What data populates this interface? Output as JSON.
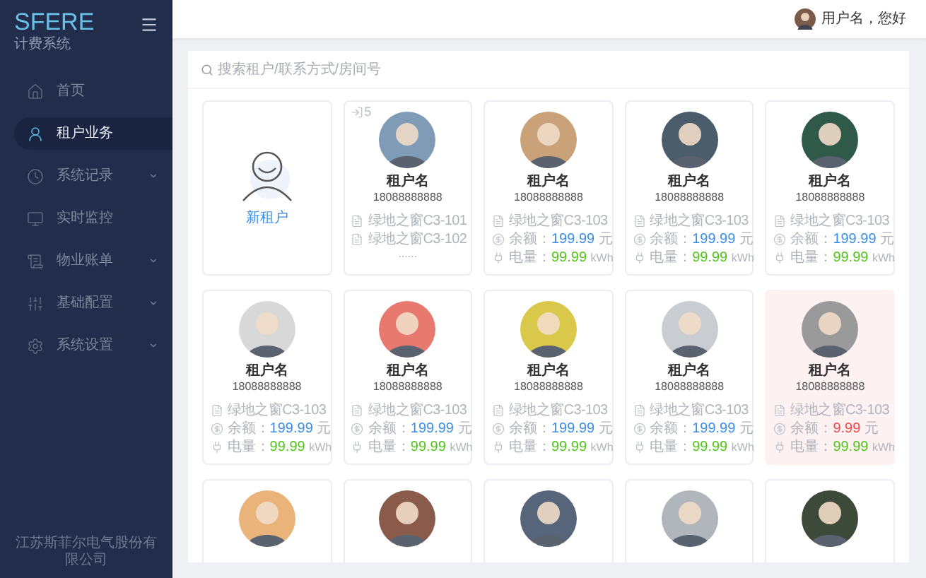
{
  "sidebar": {
    "logo": "SFERE",
    "subtitle": "计费系统",
    "items": [
      {
        "label": "首页",
        "selected": false,
        "expandable": false
      },
      {
        "label": "租户业务",
        "selected": true,
        "expandable": false
      },
      {
        "label": "系统记录",
        "selected": false,
        "expandable": true
      },
      {
        "label": "实时监控",
        "selected": false,
        "expandable": false
      },
      {
        "label": "物业账单",
        "selected": false,
        "expandable": true
      },
      {
        "label": "基础配置",
        "selected": false,
        "expandable": true
      },
      {
        "label": "系统设置",
        "selected": false,
        "expandable": true
      }
    ],
    "footer": "江苏斯菲尔电气股份有限公司"
  },
  "header": {
    "greeting": "用户名，您好"
  },
  "search": {
    "placeholder": "搜索租户/联系方式/房间号"
  },
  "cards": [
    {
      "kind": "add",
      "label": "新租户"
    },
    {
      "kind": "rooms",
      "badge": "5",
      "name": "租户名",
      "phone": "18088888888",
      "rooms": [
        "绿地之窗C3-101",
        "绿地之窗C3-102"
      ],
      "more": "......"
    },
    {
      "kind": "tenant",
      "name": "租户名",
      "phone": "18088888888",
      "rooms": [
        "绿地之窗C3-103"
      ],
      "balance_label": "余额：",
      "balance": "199.99",
      "balance_unit": "元",
      "energy_label": "电量：",
      "energy": "99.99",
      "energy_unit": "kWh",
      "low_balance": false
    },
    {
      "kind": "tenant",
      "name": "租户名",
      "phone": "18088888888",
      "rooms": [
        "绿地之窗C3-103"
      ],
      "balance_label": "余额：",
      "balance": "199.99",
      "balance_unit": "元",
      "energy_label": "电量：",
      "energy": "99.99",
      "energy_unit": "kWh",
      "low_balance": false
    },
    {
      "kind": "tenant",
      "name": "租户名",
      "phone": "18088888888",
      "rooms": [
        "绿地之窗C3-103"
      ],
      "balance_label": "余额：",
      "balance": "199.99",
      "balance_unit": "元",
      "energy_label": "电量：",
      "energy": "99.99",
      "energy_unit": "kWh",
      "low_balance": false
    },
    {
      "kind": "tenant",
      "name": "租户名",
      "phone": "18088888888",
      "rooms": [
        "绿地之窗C3-103"
      ],
      "balance_label": "余额：",
      "balance": "199.99",
      "balance_unit": "元",
      "energy_label": "电量：",
      "energy": "99.99",
      "energy_unit": "kWh",
      "low_balance": false
    },
    {
      "kind": "tenant",
      "name": "租户名",
      "phone": "18088888888",
      "rooms": [
        "绿地之窗C3-103"
      ],
      "balance_label": "余额：",
      "balance": "199.99",
      "balance_unit": "元",
      "energy_label": "电量：",
      "energy": "99.99",
      "energy_unit": "kWh",
      "low_balance": false
    },
    {
      "kind": "tenant",
      "name": "租户名",
      "phone": "18088888888",
      "rooms": [
        "绿地之窗C3-103"
      ],
      "balance_label": "余额：",
      "balance": "199.99",
      "balance_unit": "元",
      "energy_label": "电量：",
      "energy": "99.99",
      "energy_unit": "kWh",
      "low_balance": false
    },
    {
      "kind": "tenant",
      "name": "租户名",
      "phone": "18088888888",
      "rooms": [
        "绿地之窗C3-103"
      ],
      "balance_label": "余额：",
      "balance": "199.99",
      "balance_unit": "元",
      "energy_label": "电量：",
      "energy": "99.99",
      "energy_unit": "kWh",
      "low_balance": false
    },
    {
      "kind": "tenant",
      "name": "租户名",
      "phone": "18088888888",
      "rooms": [
        "绿地之窗C3-103"
      ],
      "balance_label": "余额：",
      "balance": "9.99",
      "balance_unit": "元",
      "energy_label": "电量：",
      "energy": "99.99",
      "energy_unit": "kWh",
      "low_balance": true
    },
    {
      "kind": "avatar_only"
    },
    {
      "kind": "avatar_only"
    },
    {
      "kind": "avatar_only"
    },
    {
      "kind": "avatar_only"
    },
    {
      "kind": "avatar_only"
    }
  ]
}
